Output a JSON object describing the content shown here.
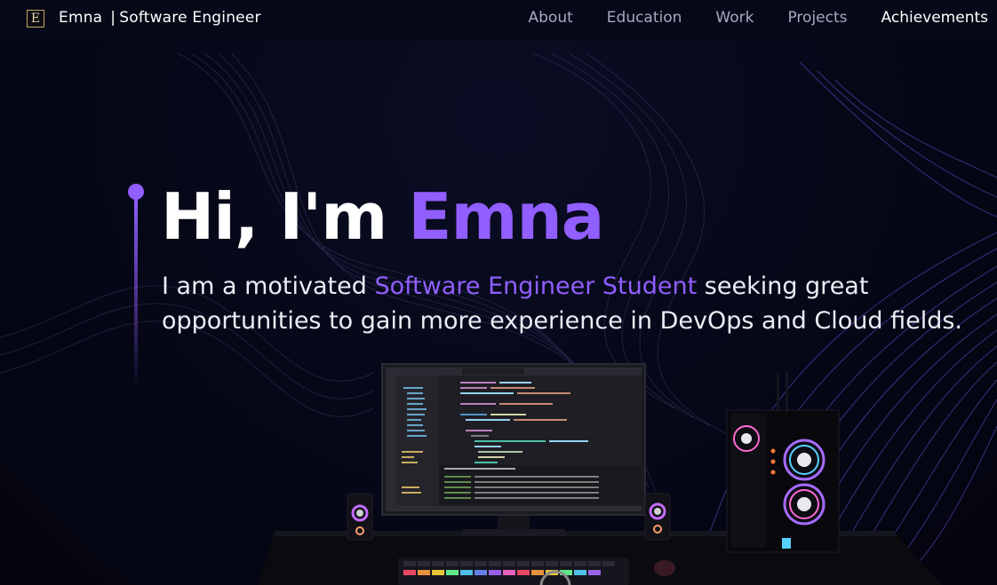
{
  "nav": {
    "logo_letter": "E",
    "brand_name": "Emna",
    "brand_separator": "|",
    "brand_role": "Software Engineer",
    "links": [
      {
        "label": "About",
        "active": false
      },
      {
        "label": "Education",
        "active": false
      },
      {
        "label": "Work",
        "active": false
      },
      {
        "label": "Projects",
        "active": false
      },
      {
        "label": "Achievements",
        "active": true
      }
    ]
  },
  "hero": {
    "greeting": "Hi, I'm ",
    "name": "Emna",
    "subtitle_start": "I am a motivated ",
    "subtitle_accent": "Software Engineer Student",
    "subtitle_end": " seeking great opportunities to gain more experience in DevOps and Cloud fields."
  },
  "colors": {
    "background": "#050816",
    "accent": "#915eff",
    "nav_text": "#aaa6c3",
    "nav_active": "#ffffff",
    "logo_border": "#c9a86a"
  },
  "icons": {
    "logo": "letter-e-logo-icon"
  }
}
